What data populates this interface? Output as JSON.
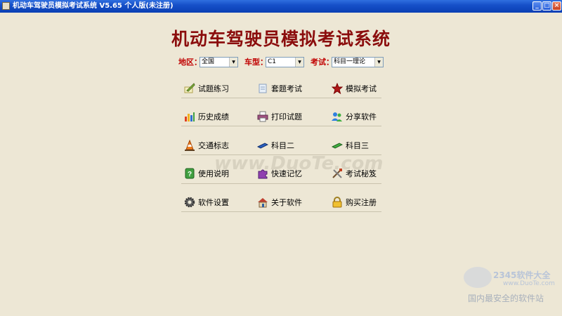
{
  "window": {
    "title": "机动车驾驶员模拟考试系统 V5.65 个人版(未注册)"
  },
  "app": {
    "title": "机动车驾驶员模拟考试系统"
  },
  "filters": {
    "region": {
      "label": "地区：",
      "value": "全国"
    },
    "vehicle": {
      "label": "车型：",
      "value": "C1"
    },
    "exam": {
      "label": "考试：",
      "value": "科目一理论"
    }
  },
  "menu": [
    {
      "label": "试题练习",
      "icon": "pencil-paper-icon"
    },
    {
      "label": "套题考试",
      "icon": "document-icon"
    },
    {
      "label": "模拟考试",
      "icon": "star-icon"
    },
    {
      "label": "历史成绩",
      "icon": "bar-chart-icon"
    },
    {
      "label": "打印试题",
      "icon": "printer-icon"
    },
    {
      "label": "分享软件",
      "icon": "users-icon"
    },
    {
      "label": "交通标志",
      "icon": "traffic-cone-icon"
    },
    {
      "label": "科目二",
      "icon": "blue-eraser-icon"
    },
    {
      "label": "科目三",
      "icon": "green-eraser-icon"
    },
    {
      "label": "使用说明",
      "icon": "help-icon"
    },
    {
      "label": "快速记忆",
      "icon": "puzzle-icon"
    },
    {
      "label": "考试秘笈",
      "icon": "tools-icon"
    },
    {
      "label": "软件设置",
      "icon": "gear-icon"
    },
    {
      "label": "关于软件",
      "icon": "house-icon"
    },
    {
      "label": "购买注册",
      "icon": "lock-icon"
    }
  ],
  "watermark": {
    "center": "www.DuoTe.com",
    "brand": "2345软件大全",
    "url": "www.DuoTe.com",
    "tagline": "国内最安全的软件站"
  }
}
